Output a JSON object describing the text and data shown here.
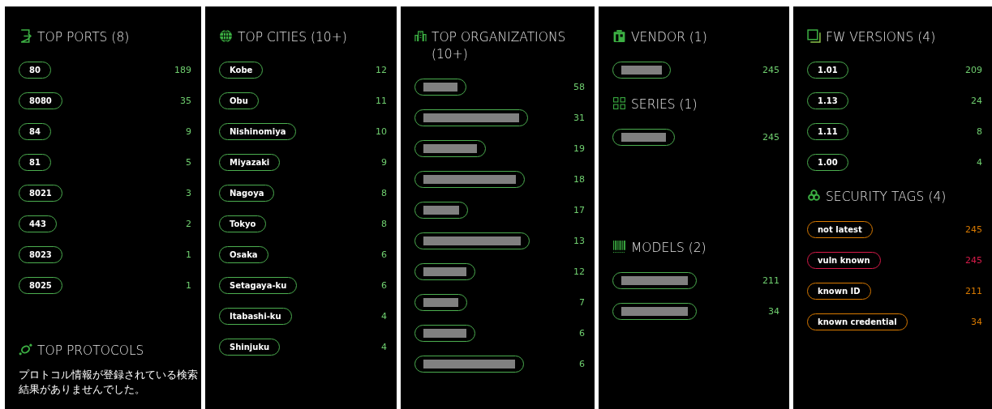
{
  "panels": [
    {
      "sections": [
        {
          "title": "TOP PORTS (8)",
          "items": [
            {
              "label": "80",
              "count": "189"
            },
            {
              "label": "8080",
              "count": "35"
            },
            {
              "label": "84",
              "count": "9"
            },
            {
              "label": "81",
              "count": "5"
            },
            {
              "label": "8021",
              "count": "3"
            },
            {
              "label": "443",
              "count": "2"
            },
            {
              "label": "8023",
              "count": "1"
            },
            {
              "label": "8025",
              "count": "1"
            }
          ]
        },
        {
          "title": "TOP PROTOCOLS",
          "note": "プロトコル情報が登録されている検索結果がありませんでした。"
        }
      ]
    },
    {
      "sections": [
        {
          "title": "TOP CITIES (10+)",
          "items": [
            {
              "label": "Kobe",
              "count": "12"
            },
            {
              "label": "Obu",
              "count": "11"
            },
            {
              "label": "Nishinomiya",
              "count": "10"
            },
            {
              "label": "Miyazaki",
              "count": "9"
            },
            {
              "label": "Nagoya",
              "count": "8"
            },
            {
              "label": "Tokyo",
              "count": "8"
            },
            {
              "label": "Osaka",
              "count": "6"
            },
            {
              "label": "Setagaya-ku",
              "count": "6"
            },
            {
              "label": "Itabashi-ku",
              "count": "4"
            },
            {
              "label": "Shinjuku",
              "count": "4"
            }
          ]
        }
      ]
    },
    {
      "sections": [
        {
          "title": "TOP ORGANIZATIONS (10+)",
          "items": [
            {
              "kind": "redacted",
              "count": "58"
            },
            {
              "kind": "redacted",
              "count": "31"
            },
            {
              "kind": "redacted",
              "count": "19"
            },
            {
              "kind": "redacted",
              "count": "18"
            },
            {
              "kind": "redacted",
              "count": "17"
            },
            {
              "kind": "redacted",
              "count": "13"
            },
            {
              "kind": "redacted",
              "count": "12"
            },
            {
              "kind": "redacted",
              "count": "7"
            },
            {
              "kind": "redacted",
              "count": "6"
            },
            {
              "kind": "redacted",
              "count": "6"
            }
          ]
        }
      ]
    },
    {
      "sections": [
        {
          "title": "VENDOR (1)",
          "items": [
            {
              "kind": "redacted",
              "count": "245"
            }
          ]
        },
        {
          "title": "SERIES (1)",
          "items": [
            {
              "kind": "redacted",
              "count": "245"
            }
          ]
        },
        {
          "title": "MODELS (2)",
          "items": [
            {
              "kind": "redacted",
              "count": "211"
            },
            {
              "kind": "redacted",
              "count": "34"
            }
          ]
        }
      ]
    },
    {
      "sections": [
        {
          "title": "FW VERSIONS (4)",
          "items": [
            {
              "label": "1.01",
              "count": "209"
            },
            {
              "label": "1.13",
              "count": "24"
            },
            {
              "label": "1.11",
              "count": "8"
            },
            {
              "label": "1.00",
              "count": "4"
            }
          ]
        },
        {
          "title": "SECURITY TAGS (4)",
          "items": [
            {
              "label": "not latest",
              "count": "245",
              "color": "#d97a00"
            },
            {
              "label": "vuln known",
              "count": "245",
              "color": "#d81b4a"
            },
            {
              "label": "known ID",
              "count": "211",
              "color": "#d97a00"
            },
            {
              "label": "known credential",
              "count": "34",
              "color": "#d97a00"
            }
          ]
        }
      ]
    }
  ]
}
